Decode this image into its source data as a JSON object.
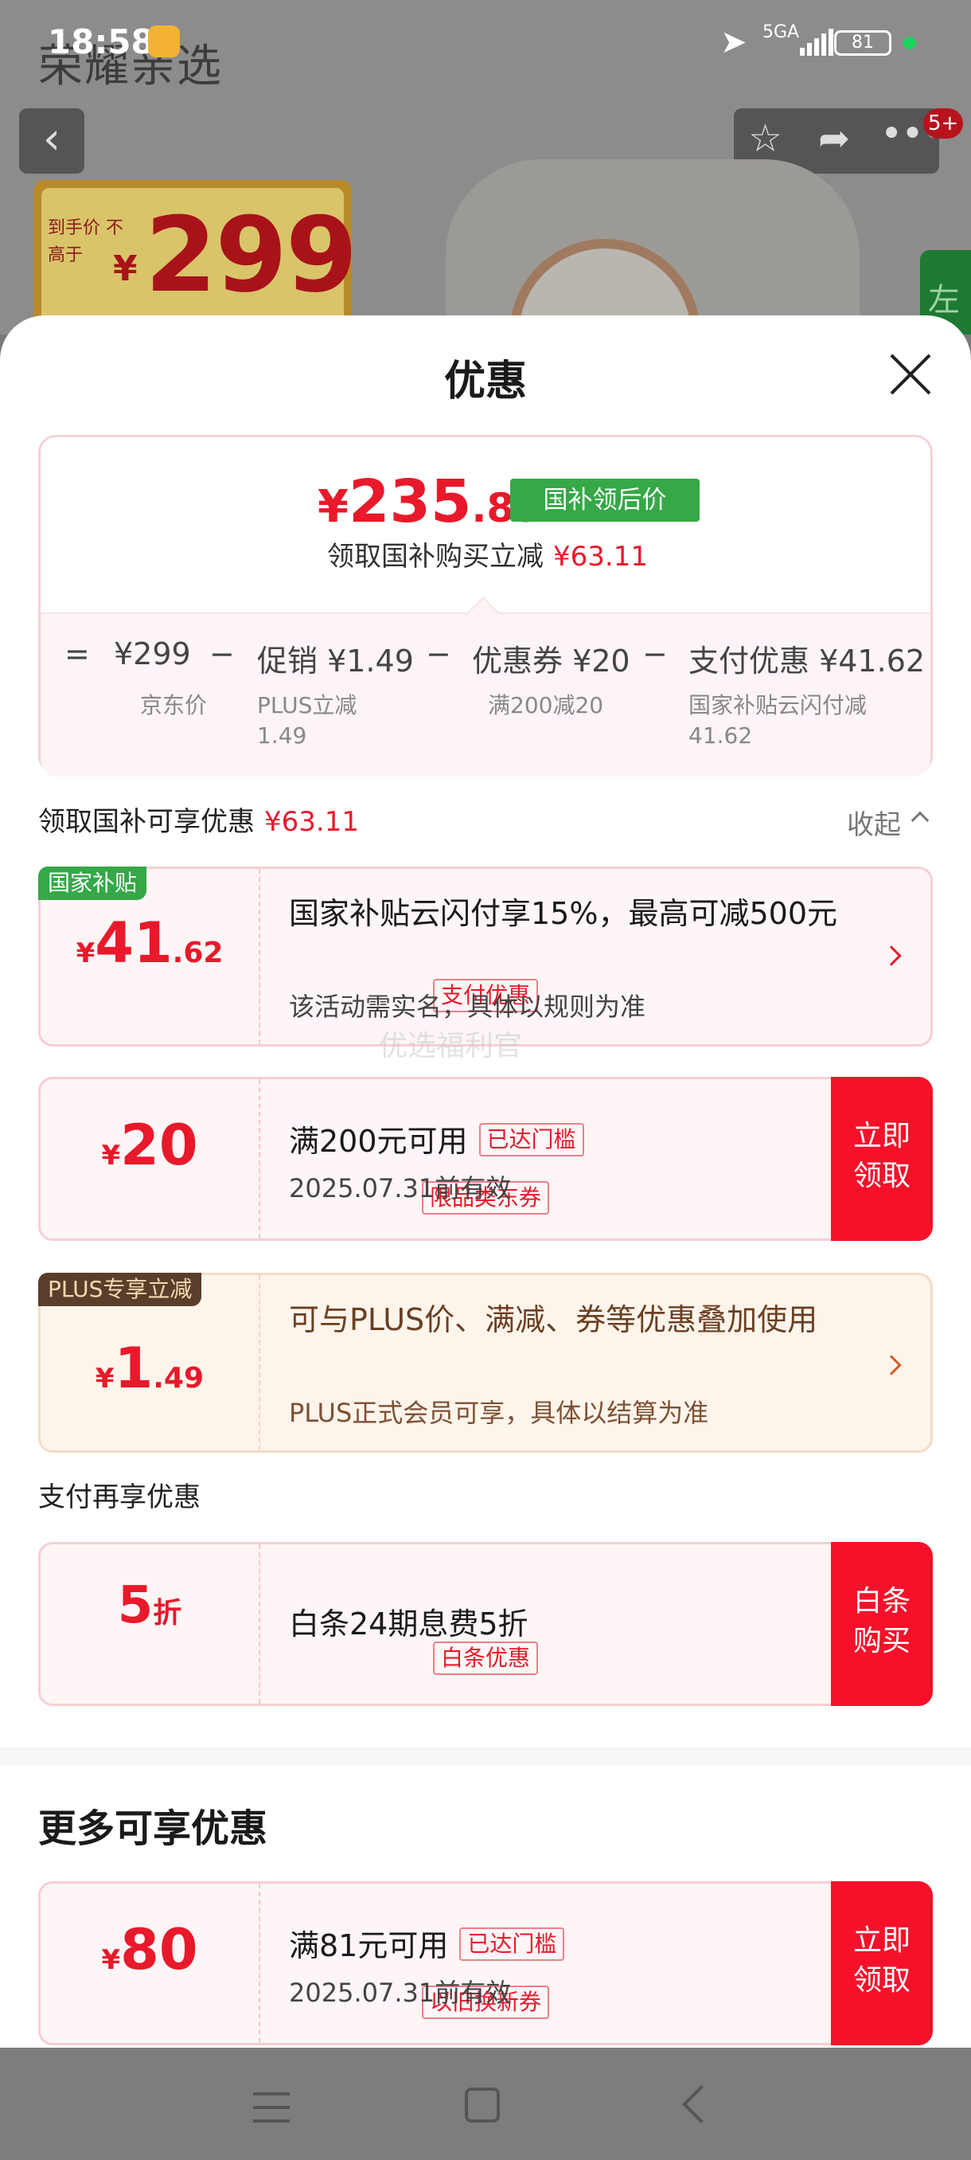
{
  "status_bar": {
    "time": "18:58",
    "network": "5GA",
    "battery": "81"
  },
  "background": {
    "store_name": "荣耀亲选",
    "price_tag_label": "到手价 不高于",
    "price_tag_yen": "¥",
    "price_tag_value": "299",
    "side_tab": "左",
    "notification_badge": "5+"
  },
  "sheet": {
    "title": "优惠",
    "summary": {
      "final_price_yen": "¥",
      "final_price_int": "235",
      "final_price_dec": ".89",
      "final_tag": "国补领后价",
      "save_label": "领取国补购买立减",
      "save_amount": "¥63.11",
      "breakdown": [
        {
          "op": "=",
          "label": "¥299",
          "sub": "京东价"
        },
        {
          "op": "−",
          "label": "促销 ¥1.49",
          "sub": "PLUS立减 1.49"
        },
        {
          "op": "−",
          "label": "优惠券 ¥20",
          "sub": "满200减20"
        },
        {
          "op": "−",
          "label": "支付优惠 ¥41.62",
          "sub": "国家补贴云闪付减 41.62"
        }
      ]
    },
    "section1": {
      "label": "领取国补可享优惠",
      "amount": "¥63.11",
      "collapse": "收起"
    },
    "offers": [
      {
        "corner": "国家补贴",
        "yen": "¥",
        "big": "41",
        "small": ".62",
        "tag": "支付优惠",
        "title": "国家补贴云闪付享15%，最高可减500元",
        "sub": "该活动需实名，具体以规则为准"
      },
      {
        "yen": "¥",
        "big": "20",
        "small": "",
        "tag": "限品类东券",
        "title": "满200元可用",
        "threshold": "已达门槛",
        "sub": "2025.07.31前有效",
        "cta": "立即领取"
      },
      {
        "corner": "PLUS专享立减",
        "yen": "¥",
        "big": "1",
        "small": ".49",
        "title": "可与PLUS价、满减、券等优惠叠加使用",
        "sub": "PLUS正式会员可享，具体以结算为准"
      }
    ],
    "section2": {
      "label": "支付再享优惠"
    },
    "payment_offer": {
      "big": "5",
      "unit": "折",
      "tag": "白条优惠",
      "title": "白条24期息费5折",
      "cta": "白条购买"
    },
    "watermark": "优选福利官",
    "more": {
      "title": "更多可享优惠",
      "offer": {
        "yen": "¥",
        "big": "80",
        "tag": "以旧换新券",
        "title": "满81元可用",
        "threshold": "已达门槛",
        "sub": "2025.07.31前有效",
        "cta": "立即领取"
      }
    }
  },
  "colors": {
    "accent_red": "#e8192a",
    "gov_green": "#35a848",
    "cta_red": "#f5112a"
  }
}
